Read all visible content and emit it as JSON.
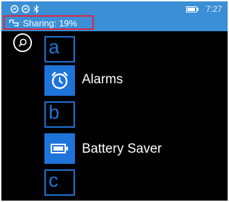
{
  "status": {
    "time": "7:27",
    "sharing_text": "Sharing: 19%"
  },
  "icons": {
    "search": "search-icon",
    "alarm": "alarm-clock-icon",
    "battery": "battery-icon"
  },
  "app_list": {
    "groups": [
      {
        "letter": "a",
        "apps": [
          "Alarms"
        ]
      },
      {
        "letter": "b",
        "apps": [
          "Battery Saver"
        ]
      },
      {
        "letter": "c",
        "apps": []
      }
    ]
  },
  "colors": {
    "accent": "#1e74d9",
    "statusbar": "#3a8fd6",
    "highlight": "#e0243c"
  }
}
